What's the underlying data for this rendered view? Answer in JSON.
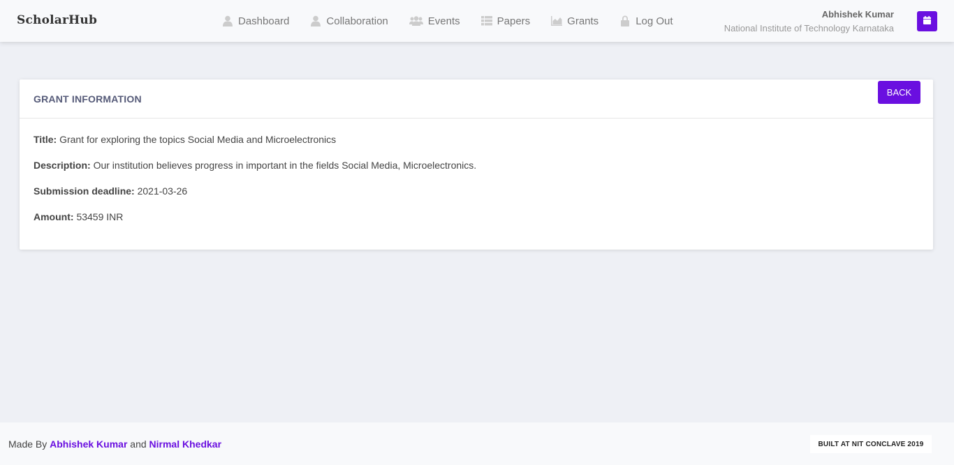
{
  "app": {
    "brand": "ScholarHub"
  },
  "nav": {
    "items": [
      {
        "label": "Dashboard",
        "icon": "user-icon"
      },
      {
        "label": "Collaboration",
        "icon": "user-icon"
      },
      {
        "label": "Events",
        "icon": "users-icon"
      },
      {
        "label": "Papers",
        "icon": "list-icon"
      },
      {
        "label": "Grants",
        "icon": "chart-icon"
      },
      {
        "label": "Log Out",
        "icon": "lock-icon"
      }
    ]
  },
  "user": {
    "name": "Abhishek Kumar",
    "institution": "National Institute of Technology Karnataka",
    "calendar_icon": "calendar-icon"
  },
  "card": {
    "title": "GRANT INFORMATION",
    "back_label": "BACK",
    "fields": [
      {
        "label": "Title:",
        "value": "Grant for exploring the topics Social Media and Microelectronics"
      },
      {
        "label": "Description:",
        "value": "Our institution believes progress in important in the fields Social Media, Microelectronics."
      },
      {
        "label": "Submission deadline:",
        "value": "2021-03-26"
      },
      {
        "label": "Amount:",
        "value": "53459 INR"
      }
    ]
  },
  "footer": {
    "made_by": "Made By",
    "author1": "Abhishek Kumar",
    "and": "and",
    "author2": "Nirmal Khedkar",
    "badge": "BUILT AT NIT CONCLAVE 2019"
  },
  "colors": {
    "accent": "#6a0fe0",
    "background": "#eef0f5",
    "nav_text": "#777777"
  }
}
